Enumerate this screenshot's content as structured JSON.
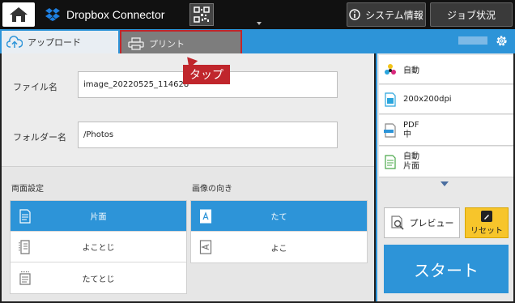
{
  "topbar": {
    "app_title": "Dropbox Connector",
    "system_info_label": "システム情報",
    "job_status_label": "ジョブ状況"
  },
  "tabs": {
    "upload_label": "アップロード",
    "print_label": "プリント"
  },
  "callout": {
    "text": "タップ"
  },
  "form": {
    "filename_label": "ファイル名",
    "filename_value": "image_20220525_114628",
    "folder_label": "フォルダー名",
    "folder_value": "/Photos"
  },
  "duplex": {
    "title": "両面設定",
    "options": [
      "片面",
      "よことじ",
      "たてとじ"
    ],
    "selected": "片面"
  },
  "orientation": {
    "title": "画像の向き",
    "options": [
      "たて",
      "よこ"
    ],
    "selected": "たて"
  },
  "settings": {
    "color": "自動",
    "resolution": "200x200dpi",
    "format_line1": "PDF",
    "format_line2": "中",
    "sides_line1": "自動",
    "sides_line2": "片面"
  },
  "actions": {
    "preview_label": "プレビュー",
    "reset_label": "リセット",
    "start_label": "スタート"
  },
  "colors": {
    "accent": "#2d94d8",
    "callout": "#c0262c",
    "reset": "#f7c52b"
  },
  "icons": [
    "home-icon",
    "dropbox-icon",
    "qr-code-icon",
    "info-icon",
    "cloud-upload-icon",
    "printer-icon",
    "gear-icon",
    "color-icon",
    "resolution-icon",
    "pdf-icon",
    "document-icon",
    "preview-icon",
    "pen-icon"
  ]
}
